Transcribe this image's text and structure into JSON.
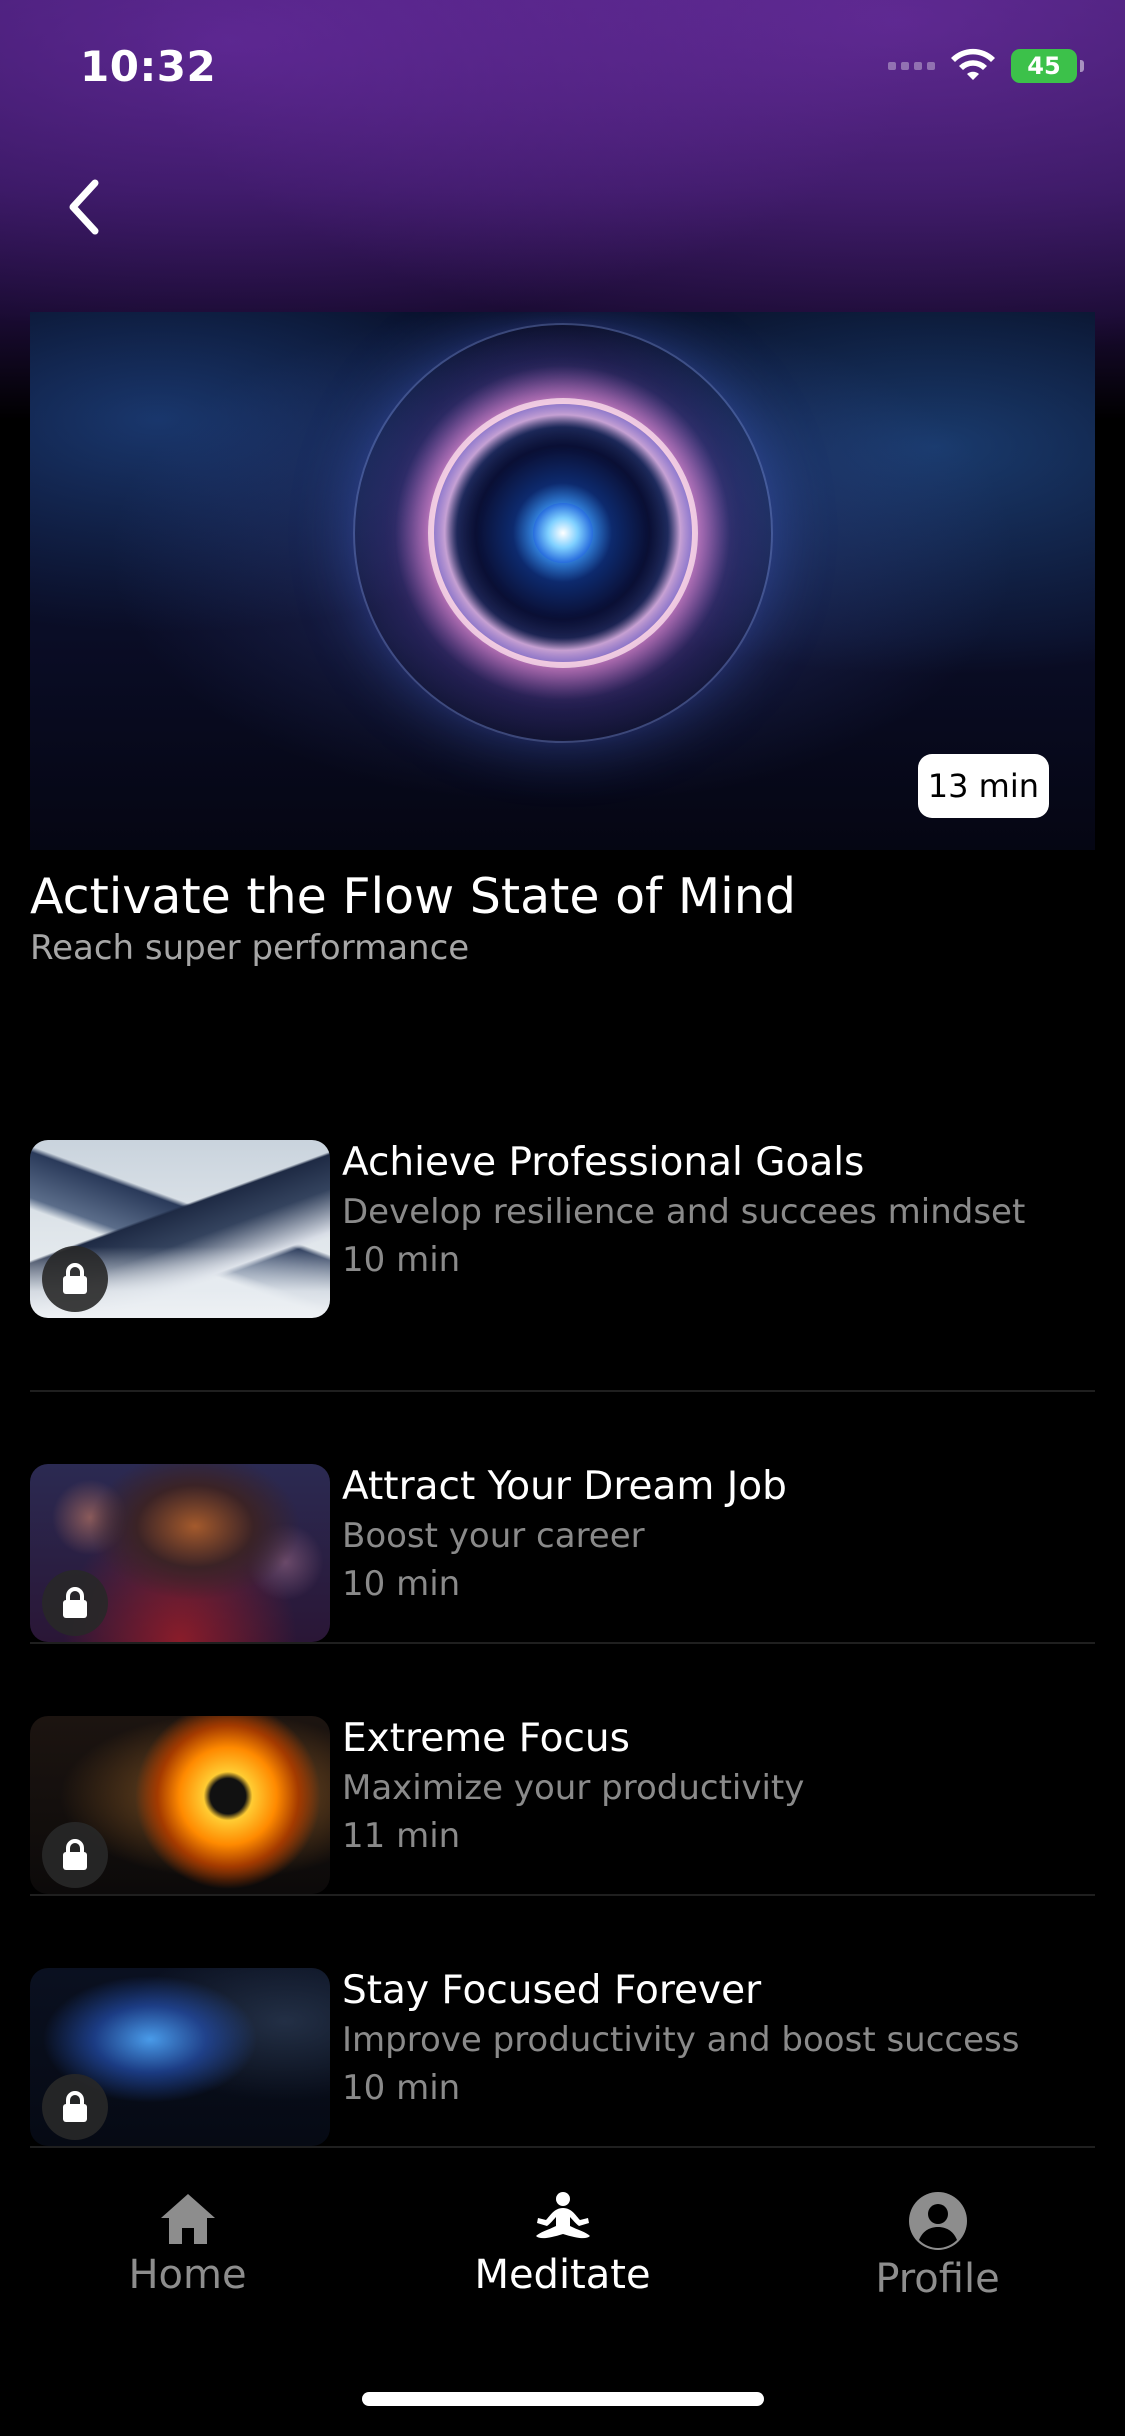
{
  "status_bar": {
    "time": "10:32",
    "battery": "45"
  },
  "hero": {
    "duration": "13 min",
    "title": "Activate the Flow State of Mind",
    "subtitle": "Reach super performance"
  },
  "meditations": [
    {
      "title": "Achieve Professional Goals",
      "subtitle": "Develop resilience and succees mindset",
      "duration": "10 min",
      "locked": true
    },
    {
      "title": "Attract Your Dream Job",
      "subtitle": "Boost your career",
      "duration": "10 min",
      "locked": true
    },
    {
      "title": "Extreme Focus",
      "subtitle": "Maximize your productivity",
      "duration": "11 min",
      "locked": true
    },
    {
      "title": "Stay Focused Forever",
      "subtitle": "Improve productivity and boost success",
      "duration": "10 min",
      "locked": true
    }
  ],
  "tabbar": {
    "items": [
      {
        "label": "Home",
        "icon": "home-icon",
        "active": false
      },
      {
        "label": "Meditate",
        "icon": "meditate-icon",
        "active": true
      },
      {
        "label": "Profile",
        "icon": "profile-icon",
        "active": false
      }
    ]
  },
  "colors": {
    "background": "#000000",
    "header_purple": "#3a1a66",
    "battery_green": "#3cc14a",
    "muted_text": "#8a8a8a"
  }
}
